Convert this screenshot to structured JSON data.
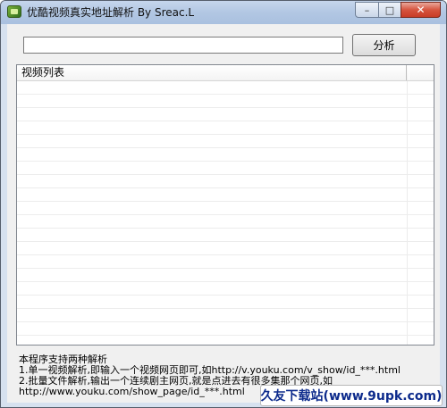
{
  "window": {
    "title": "优酷视频真实地址解析 By Sreac.L",
    "controls": {
      "minimize": "–",
      "maximize": "□",
      "close": "✕"
    },
    "icon": "app-icon"
  },
  "toolbar": {
    "url_value": "",
    "analyze_label": "分析"
  },
  "list": {
    "columns": [
      "视频列表"
    ],
    "rows": []
  },
  "info": {
    "line1": "本程序支持两种解析",
    "line2": "1.单一视频解析,即输入一个视频网页即可,如http://v.youku.com/v_show/id_***.html",
    "line3": "2.批量文件解析,输出一个连续剧主网页,就是点进去有很多集那个网页,如",
    "line4": "http://www.youku.com/show_page/id_***.html"
  },
  "watermark": {
    "text": "久友下载站(www.9upk.com)"
  }
}
